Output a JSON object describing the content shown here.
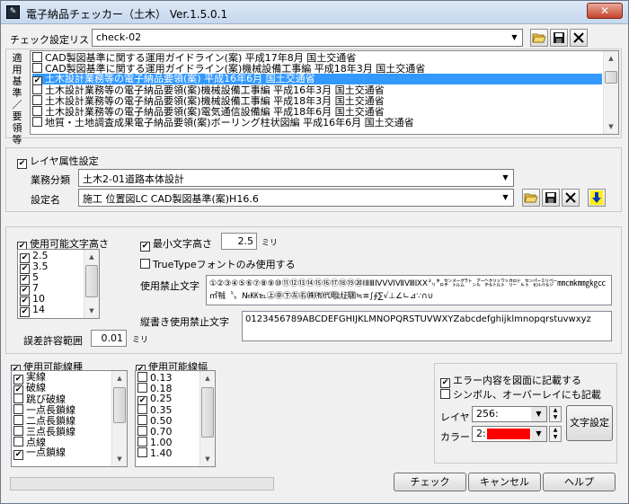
{
  "window": {
    "title": "電子納品チェッカー（土木） Ver.1.5.0.1",
    "close": "✕"
  },
  "check_list": {
    "label": "チェック設定リスト",
    "value": "check-02",
    "vertical_label": [
      "適",
      "用",
      "基",
      "準",
      "／",
      "要",
      "領",
      "等"
    ],
    "items": [
      {
        "text": "CAD製図基準に関する運用ガイドライン(案)  平成17年8月  国土交通省",
        "checked": false,
        "selected": false
      },
      {
        "text": "CAD製図基準に関する運用ガイドライン(案)機械設備工事編  平成18年3月  国土交通省",
        "checked": false,
        "selected": false
      },
      {
        "text": "土木設計業務等の電子納品要領(案)  平成16年6月  国土交通省",
        "checked": true,
        "selected": true
      },
      {
        "text": "土木設計業務等の電子納品要領(案)機械設備工事編  平成16年3月  国土交通省",
        "checked": false,
        "selected": false
      },
      {
        "text": "土木設計業務等の電子納品要領(案)機械設備工事編  平成18年3月  国土交通省",
        "checked": false,
        "selected": false
      },
      {
        "text": "土木設計業務等の電子納品要領(案)電気通信設備編  平成18年6月  国土交通省",
        "checked": false,
        "selected": false
      },
      {
        "text": "地質・土地調査成果電子納品要領(案)ボーリング柱状図編  平成16年6月  国土交通省",
        "checked": false,
        "selected": false
      }
    ]
  },
  "layer": {
    "checkbox_label": "レイヤ属性設定",
    "business_label": "業務分類",
    "business_value": "土木2-01道路本体設計",
    "setting_label": "設定名",
    "setting_value": "施工 位置図LC CAD製図基準(案)H16.6"
  },
  "char_height": {
    "label": "使用可能文字高さ",
    "items": [
      "2.5",
      "3.5",
      "5",
      "7",
      "10",
      "14"
    ],
    "min_label": "最小文字高さ",
    "min_value": "2.5",
    "min_unit": "ミリ",
    "truetype_label": "TrueTypeフォントのみ使用する",
    "prohibited_label": "使用禁止文字",
    "prohibited_chars": "①②③④⑤⑥⑦⑧⑨⑩⑪⑫⑬⑭⑮⑯⑰⑱⑲⑳ⅠⅡⅢⅣⅤⅥⅦⅧⅨⅩ㍉㌔㌢㍍㌘㌧㌃㌶㍑㍗㌍㌦㌣㌫㍊㌻㎜㎝㎞㎎㎏㏄㎡㍻〝〟№㏍℡㊤㊥㊦㊧㊨㈱㈲㈹㍾㍽㍼≒≡∫∮∑√⊥∠∟⊿∵∩∪",
    "vertical_label": "縦書き使用禁止文字",
    "vertical_chars": "0123456789ABCDEFGHIJKLMNOPQRSTUVWXYZabcdefghijklmnopqrstuvwxyz",
    "tolerance_label": "誤差許容範囲",
    "tolerance_value": "0.01",
    "tolerance_unit": "ミリ"
  },
  "line_type": {
    "label": "使用可能線種",
    "items": [
      {
        "text": "実線",
        "checked": true
      },
      {
        "text": "破線",
        "checked": true
      },
      {
        "text": "跳び破線",
        "checked": false
      },
      {
        "text": "一点長鎖線",
        "checked": false
      },
      {
        "text": "二点長鎖線",
        "checked": false
      },
      {
        "text": "三点長鎖線",
        "checked": false
      },
      {
        "text": "点線",
        "checked": false
      },
      {
        "text": "一点鎖線",
        "checked": true
      }
    ]
  },
  "line_width": {
    "label": "使用可能線幅",
    "items": [
      {
        "text": "0.13",
        "checked": false
      },
      {
        "text": "0.18",
        "checked": false
      },
      {
        "text": "0.25",
        "checked": true
      },
      {
        "text": "0.35",
        "checked": false
      },
      {
        "text": "0.50",
        "checked": false
      },
      {
        "text": "0.70",
        "checked": false
      },
      {
        "text": "1.00",
        "checked": false
      },
      {
        "text": "1.40",
        "checked": false
      }
    ]
  },
  "error_out": {
    "write_label": "エラー内容を図面に記載する",
    "symbol_label": "シンボル、オーバーレイにも記載",
    "layer_label": "レイヤ",
    "layer_value": "256:",
    "color_label": "カラー",
    "color_value": "2:",
    "color_swatch": "#ff0000",
    "font_button": "文字設定"
  },
  "buttons": {
    "check": "チェック",
    "cancel": "キャンセル",
    "help": "ヘルプ"
  },
  "icons": {
    "open": "folder-open-icon",
    "save": "floppy-disk-icon",
    "delete": "x-delete-icon",
    "down": "yellow-down-arrow-icon"
  }
}
